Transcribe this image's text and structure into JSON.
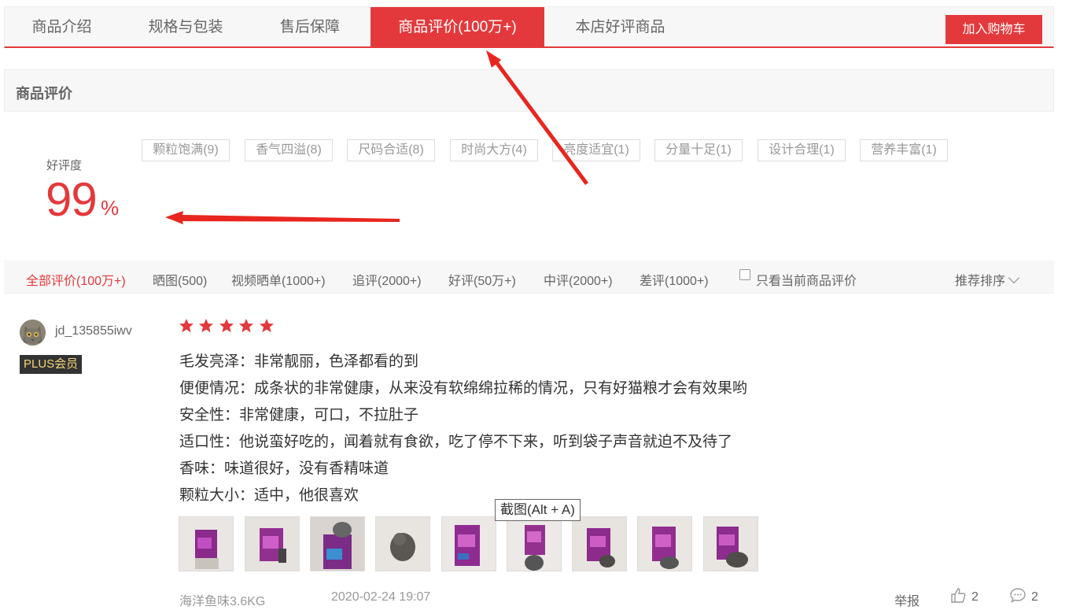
{
  "tabs": [
    {
      "label": "商品介绍",
      "active": false
    },
    {
      "label": "规格与包装",
      "active": false
    },
    {
      "label": "售后保障",
      "active": false
    },
    {
      "label": "商品评价(100万+)",
      "active": true
    },
    {
      "label": "本店好评商品",
      "active": false
    }
  ],
  "cart_button": "加入购物车",
  "section_title": "商品评价",
  "rating": {
    "label": "好评度",
    "value": "99",
    "unit": "%"
  },
  "tags": [
    "颗粒饱满(9)",
    "香气四溢(8)",
    "尺码合适(8)",
    "时尚大方(4)",
    "亮度适宜(1)",
    "分量十足(1)",
    "设计合理(1)",
    "营养丰富(1)"
  ],
  "filters": [
    {
      "label": "全部评价(100万+)",
      "active": true
    },
    {
      "label": "晒图(500)",
      "active": false
    },
    {
      "label": "视频晒单(1000+)",
      "active": false
    },
    {
      "label": "追评(2000+)",
      "active": false
    },
    {
      "label": "好评(50万+)",
      "active": false
    },
    {
      "label": "中评(2000+)",
      "active": false
    },
    {
      "label": "差评(1000+)",
      "active": false
    }
  ],
  "only_current_label": "只看当前商品评价",
  "sort_label": "推荐排序",
  "review": {
    "username": "jd_135855iwv",
    "badge": "PLUS会员",
    "stars": 5,
    "lines": [
      "毛发亮泽：非常靓丽，色泽都看的到",
      "便便情况：成条状的非常健康，从来没有软绵绵拉稀的情况，只有好猫粮才会有效果哟",
      "安全性：非常健康，可口，不拉肚子",
      "适口性：他说蛮好吃的，闻着就有食欲，吃了停不下来，听到袋子声音就迫不及待了",
      "香味：味道很好，没有香精味道",
      "颗粒大小：适中，他很喜欢"
    ],
    "product": "海洋鱼味3.6KG",
    "date": "2020-02-24 19:07",
    "report": "举报",
    "likes": "2",
    "comments": "2"
  },
  "tooltip": "截图(Alt + A)",
  "colors": {
    "accent": "#e4393c",
    "arrow": "#e8261f"
  }
}
